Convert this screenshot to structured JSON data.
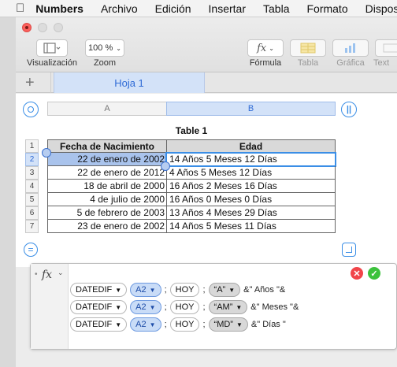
{
  "menubar": {
    "app": "Numbers",
    "items": [
      "Archivo",
      "Edición",
      "Insertar",
      "Tabla",
      "Formato",
      "Dispos"
    ]
  },
  "toolbar": {
    "view_label": "Visualización",
    "zoom_value": "100 %",
    "zoom_label": "Zoom",
    "formula_icon": "fx",
    "formula_label": "Fórmula",
    "table_label": "Tabla",
    "chart_label": "Gráfica",
    "text_label": "Text"
  },
  "tabs": {
    "active": "Hoja 1"
  },
  "columns": {
    "a": "A",
    "b": "B"
  },
  "table": {
    "title": "Table 1",
    "headers": [
      "Fecha de Nacimiento",
      "Edad"
    ],
    "row_numbers": [
      "1",
      "2",
      "3",
      "4",
      "5",
      "6",
      "7"
    ],
    "rows": [
      {
        "date": "22 de enero de 2002",
        "age": "14 Años 5 Meses 12 Días"
      },
      {
        "date": "22 de enero de 2012",
        "age": "4 Años 5 Meses 12 Días"
      },
      {
        "date": "18 de abril de 2000",
        "age": "16 Años 2 Meses 16 Días"
      },
      {
        "date": "4 de julio de 2000",
        "age": "16 Años 0 Meses 0 Días"
      },
      {
        "date": "5 de febrero de 2003",
        "age": "13 Años 4 Meses 29 Días"
      },
      {
        "date": "23 de enero de 2002",
        "age": "14 Años 5 Meses 11 Días"
      }
    ]
  },
  "formula": {
    "fx": "fx",
    "rows": [
      {
        "func": "DATEDIF",
        "ref": "A2",
        "today": "HOY",
        "unit": "“A”",
        "tail": "&\" Años \"&"
      },
      {
        "func": "DATEDIF",
        "ref": "A2",
        "today": "HOY",
        "unit": "“AM”",
        "tail": "&\" Meses \"&"
      },
      {
        "func": "DATEDIF",
        "ref": "A2",
        "today": "HOY",
        "unit": "“MD”",
        "tail": "&\" Días \""
      }
    ],
    "separator": ";"
  },
  "colors": {
    "accent": "#3a8ee6",
    "cancel": "#f1454a",
    "accept": "#3cc23c",
    "selection": "#a9c3ec"
  }
}
